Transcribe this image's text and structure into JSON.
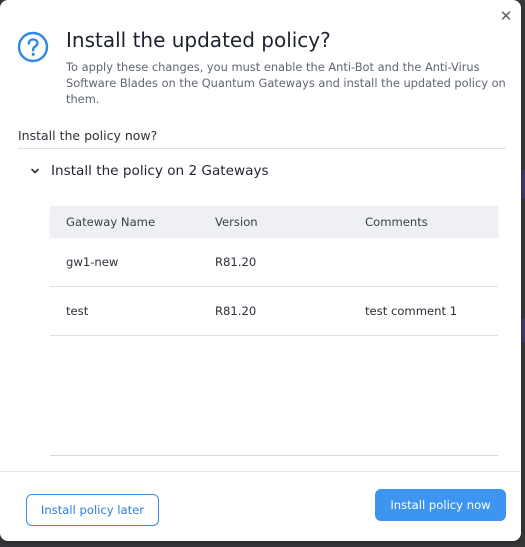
{
  "dialog": {
    "close_glyph": "✕",
    "title": "Install the updated policy?",
    "description": "To apply these changes, you must enable the Anti-Bot and the Anti-Virus Software Blades on the Quantum Gateways and install the updated policy on them.",
    "question": "Install the policy now?",
    "section_label": "Install the policy on 2 Gateways",
    "table": {
      "headers": [
        "Gateway Name",
        "Version",
        "Comments"
      ],
      "rows": [
        [
          "gw1-new",
          "R81.20",
          ""
        ],
        [
          "test",
          "R81.20",
          "test comment 1"
        ]
      ]
    },
    "buttons": {
      "later": "Install policy later",
      "now": "Install policy now"
    }
  },
  "colors": {
    "accent": "#3d95f0",
    "help_icon": "#2f8ae6"
  },
  "icons": {
    "help": "question-circle-icon",
    "close": "close-icon",
    "section": "chevron-down-icon"
  }
}
